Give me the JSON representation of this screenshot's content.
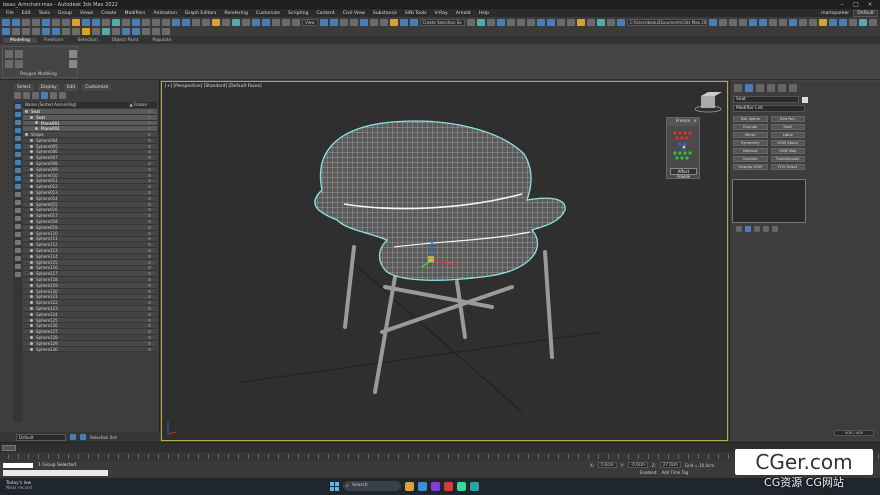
{
  "app": {
    "title": "beau_Armchair.max - Autodesk 3ds Max 2022",
    "user": "marioparker",
    "workspace": "Default"
  },
  "menu": [
    "File",
    "Edit",
    "Tools",
    "Group",
    "Views",
    "Create",
    "Modifiers",
    "Animation",
    "Graph Editors",
    "Rendering",
    "Customize",
    "Scripting",
    "Content",
    "Civil View",
    "Substance",
    "SiNi Tools",
    "V-Ray",
    "Arnold",
    "Help"
  ],
  "toolbar": {
    "view_dropdown": "View",
    "selection_set": "Create Selection Se",
    "path": "C:\\Users\\beau\\Documents\\3ds Max 2022"
  },
  "ribbon": {
    "tabs": [
      "Modeling",
      "Freeform",
      "Selection",
      "Object Paint",
      "Populate"
    ],
    "group_label": "Polygon Modeling"
  },
  "scene_explorer": {
    "tabs": [
      "Select",
      "Display",
      "Edit",
      "Customize"
    ],
    "col_name": "Name (Sorted Ascending)",
    "col_frozen": "▲ Frozen",
    "rows": [
      {
        "name": "Seat",
        "indent": 0,
        "sel": true
      },
      {
        "name": "Seat",
        "indent": 1,
        "sel": true
      },
      {
        "name": "Plane001",
        "indent": 2,
        "sel": true
      },
      {
        "name": "Plane002",
        "indent": 2,
        "sel": true
      },
      {
        "name": "Shape",
        "indent": 0,
        "sel": false
      },
      {
        "name": "Sphere004",
        "indent": 1,
        "sel": false
      },
      {
        "name": "Sphere005",
        "indent": 1,
        "sel": false
      },
      {
        "name": "Sphere006",
        "indent": 1,
        "sel": false
      },
      {
        "name": "Sphere007",
        "indent": 1,
        "sel": false
      },
      {
        "name": "Sphere008",
        "indent": 1,
        "sel": false
      },
      {
        "name": "Sphere009",
        "indent": 1,
        "sel": false
      },
      {
        "name": "Sphere010",
        "indent": 1,
        "sel": false
      },
      {
        "name": "Sphere011",
        "indent": 1,
        "sel": false
      },
      {
        "name": "Sphere012",
        "indent": 1,
        "sel": false
      },
      {
        "name": "Sphere013",
        "indent": 1,
        "sel": false
      },
      {
        "name": "Sphere014",
        "indent": 1,
        "sel": false
      },
      {
        "name": "Sphere015",
        "indent": 1,
        "sel": false
      },
      {
        "name": "Sphere016",
        "indent": 1,
        "sel": false
      },
      {
        "name": "Sphere017",
        "indent": 1,
        "sel": false
      },
      {
        "name": "Sphere018",
        "indent": 1,
        "sel": false
      },
      {
        "name": "Sphere019",
        "indent": 1,
        "sel": false
      },
      {
        "name": "Sphere110",
        "indent": 1,
        "sel": false
      },
      {
        "name": "Sphere111",
        "indent": 1,
        "sel": false
      },
      {
        "name": "Sphere112",
        "indent": 1,
        "sel": false
      },
      {
        "name": "Sphere113",
        "indent": 1,
        "sel": false
      },
      {
        "name": "Sphere114",
        "indent": 1,
        "sel": false
      },
      {
        "name": "Sphere115",
        "indent": 1,
        "sel": false
      },
      {
        "name": "Sphere116",
        "indent": 1,
        "sel": false
      },
      {
        "name": "Sphere117",
        "indent": 1,
        "sel": false
      },
      {
        "name": "Sphere118",
        "indent": 1,
        "sel": false
      },
      {
        "name": "Sphere119",
        "indent": 1,
        "sel": false
      },
      {
        "name": "Sphere120",
        "indent": 1,
        "sel": false
      },
      {
        "name": "Sphere121",
        "indent": 1,
        "sel": false
      },
      {
        "name": "Sphere122",
        "indent": 1,
        "sel": false
      },
      {
        "name": "Sphere123",
        "indent": 1,
        "sel": false
      },
      {
        "name": "Sphere124",
        "indent": 1,
        "sel": false
      },
      {
        "name": "Sphere125",
        "indent": 1,
        "sel": false
      },
      {
        "name": "Sphere126",
        "indent": 1,
        "sel": false
      },
      {
        "name": "Sphere127",
        "indent": 1,
        "sel": false
      },
      {
        "name": "Sphere128",
        "indent": 1,
        "sel": false
      },
      {
        "name": "Sphere129",
        "indent": 1,
        "sel": false
      },
      {
        "name": "Sphere130",
        "indent": 1,
        "sel": false
      }
    ],
    "layer_field": "Default",
    "selection_set_label": "Selection Set:"
  },
  "viewport": {
    "label": "[+] [Perspective] [Standard] [Default Faces]"
  },
  "freeze_dialog": {
    "title": "Freeze",
    "button": "Affect Freeze"
  },
  "command_panel": {
    "object_name": "Seat",
    "modifier_list": "Modifier List",
    "buttons": [
      "Edit Spline",
      "Edit Poly",
      "Extrude",
      "Shell",
      "Mirror",
      "Lathe",
      "Symmetry",
      "UVW Xform",
      "Material",
      "UVW Map",
      "Chamfer",
      "TurboSmooth",
      "Unwrap UVW",
      "FFD Select"
    ],
    "count": "400 / 400"
  },
  "status": {
    "selection": "1 Group Selected",
    "x": "0.0cm",
    "y": "-0.0cm",
    "z": "27.0cm",
    "grid": "Grid = 10.0cm",
    "time_tag": "Add Time Tag",
    "enabled": "Enabled:"
  },
  "taskbar": {
    "weather_line1": "Today's low",
    "weather_line2": "Near record",
    "search": "Search"
  },
  "watermark": {
    "line1": "CGer.com",
    "line2": "CG资源 CG网站"
  }
}
